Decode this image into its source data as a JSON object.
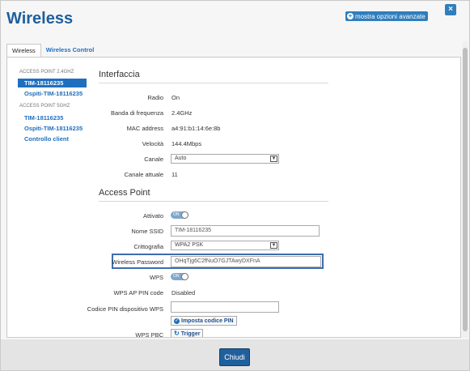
{
  "header": {
    "title": "Wireless",
    "advanced_label": "mostra opzioni avanzate",
    "close_icon": "close-icon"
  },
  "tabs": [
    {
      "label": "Wireless",
      "active": true
    },
    {
      "label": "Wireless Control",
      "active": false
    }
  ],
  "sidebar": {
    "heading_24": "ACCESS POINT 2.4GHZ",
    "heading_5": "ACCESS POINT 5GHZ",
    "items": [
      {
        "label": "TIM-18116235",
        "selected": true
      },
      {
        "label": "Ospiti-TIM-18116235",
        "selected": false
      },
      {
        "label": "TIM-18116235",
        "selected": false
      },
      {
        "label": "Ospiti-TIM-18116235",
        "selected": false
      },
      {
        "label": "Controllo client",
        "selected": false
      }
    ]
  },
  "interfaccia": {
    "title": "Interfaccia",
    "radio_label": "Radio",
    "radio_value": "On",
    "band_label": "Banda di frequenza",
    "band_value": "2.4GHz",
    "mac_label": "MAC address",
    "mac_value": "a4:91:b1:14:6e:8b",
    "speed_label": "Velocità",
    "speed_value": "144.4Mbps",
    "channel_label": "Canale",
    "channel_value": "Auto",
    "current_channel_label": "Canale attuale",
    "current_channel_value": "11"
  },
  "access_point": {
    "title": "Access Point",
    "enabled_label": "Attivato",
    "enabled_toggle": "ON",
    "ssid_label": "Nome SSID",
    "ssid_value": "TIM-18116235",
    "crypto_label": "Crittografia",
    "crypto_value": "WPA2 PSK",
    "password_label": "Wireless Password",
    "password_value": "OHqTjg6C2fNuO7GJTAwyDXFnA",
    "wps_label": "WPS",
    "wps_toggle": "ON",
    "wps_pin_label": "WPS AP PIN code",
    "wps_pin_value": "Disabled",
    "pin_device_label": "Codice PIN dispositivo WPS",
    "pin_device_value": "",
    "set_pin_label": "Imposta codice PIN",
    "wps_pbc_label": "WPS PBC",
    "trigger_label": "Trigger"
  },
  "footer": {
    "close_label": "Chiudi"
  },
  "colors": {
    "accent": "#1f6fbf",
    "title": "#1f5f9c",
    "highlight_border": "#3c6db0"
  }
}
